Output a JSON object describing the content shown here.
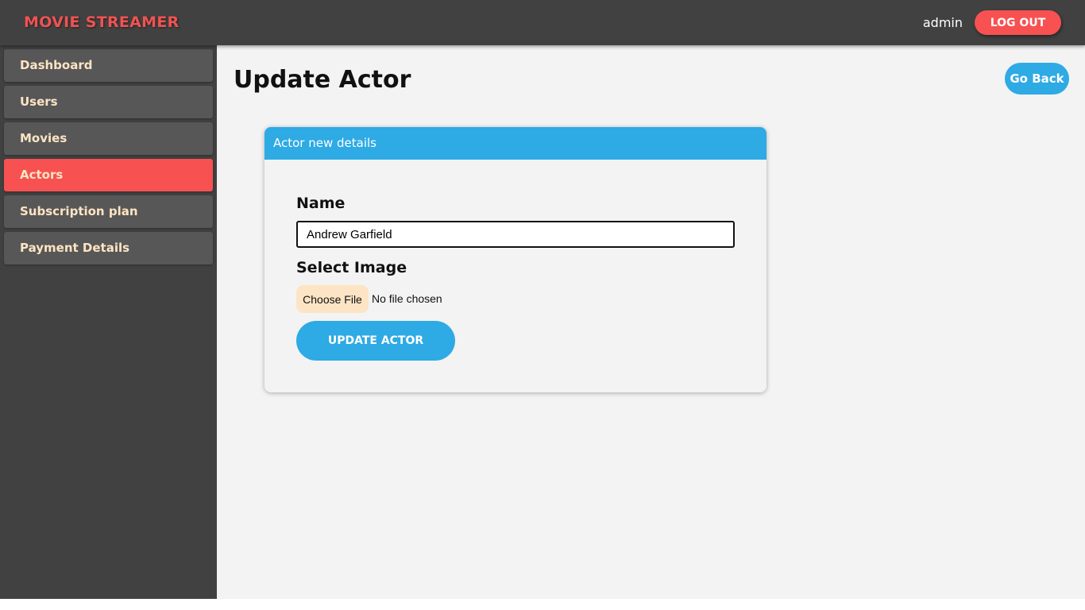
{
  "header": {
    "brand": "MOVIE STREAMER",
    "username": "admin",
    "logout_label": "LOG OUT"
  },
  "sidebar": {
    "items": [
      {
        "label": "Dashboard",
        "active": false
      },
      {
        "label": "Users",
        "active": false
      },
      {
        "label": "Movies",
        "active": false
      },
      {
        "label": "Actors",
        "active": true
      },
      {
        "label": "Subscription plan",
        "active": false
      },
      {
        "label": "Payment Details",
        "active": false
      }
    ]
  },
  "main": {
    "title": "Update Actor",
    "go_back_label": "Go Back",
    "card": {
      "header": "Actor new details",
      "name_label": "Name",
      "name_value": "Andrew Garfield",
      "image_label": "Select Image",
      "choose_file_label": "Choose File",
      "no_file_text": "No file chosen",
      "submit_label": "UPDATE ACTOR"
    }
  },
  "colors": {
    "accent_blue": "#2eaae5",
    "accent_red": "#f75151",
    "nav_text": "#fde4c4",
    "dark_bg": "#414141"
  }
}
